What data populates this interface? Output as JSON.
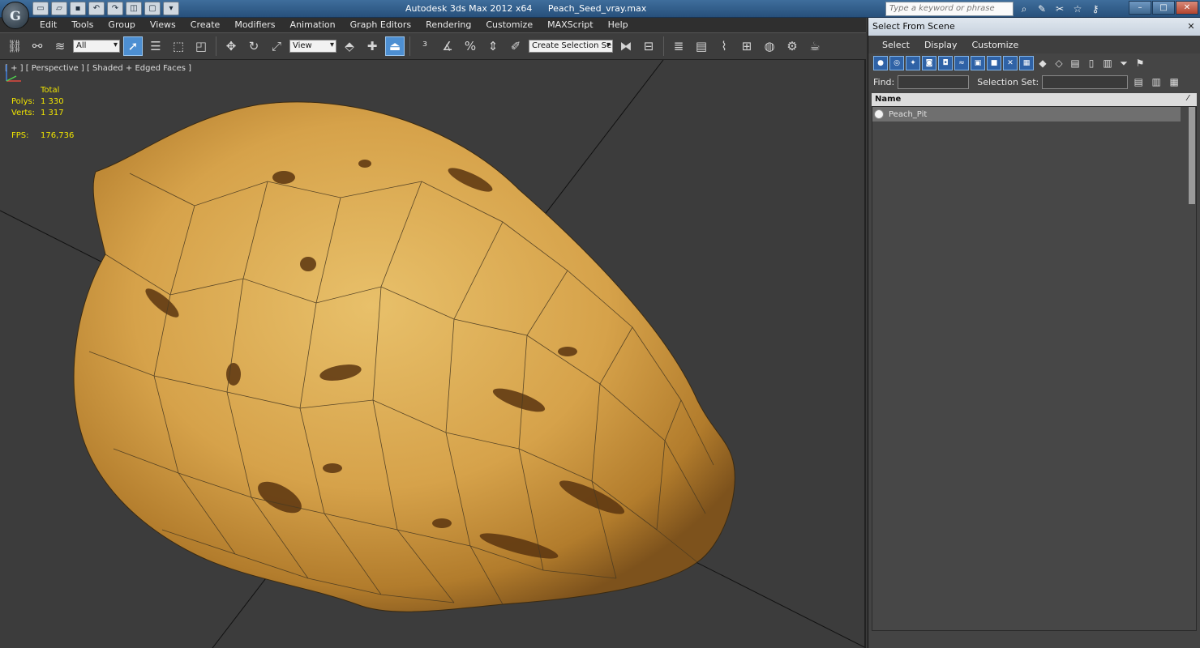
{
  "app": {
    "logo_letter": "G",
    "title_app": "Autodesk 3ds Max  2012 x64",
    "title_file": "Peach_Seed_vray.max",
    "search_placeholder": "Type a keyword or phrase"
  },
  "menus": [
    "Edit",
    "Tools",
    "Group",
    "Views",
    "Create",
    "Modifiers",
    "Animation",
    "Graph Editors",
    "Rendering",
    "Customize",
    "MAXScript",
    "Help"
  ],
  "toolbar": {
    "selection_filter": "All",
    "reference_coord": "View",
    "named_selection": "Create Selection Se"
  },
  "viewport": {
    "label": "[ + ] [ Perspective ] [ Shaded + Edged Faces ]",
    "stats_header": "Total",
    "polys_label": "Polys:",
    "polys_value": "1 330",
    "verts_label": "Verts:",
    "verts_value": "1 317",
    "fps_label": "FPS:",
    "fps_value": "176,736"
  },
  "panel": {
    "title": "Select From Scene",
    "menu": [
      "Select",
      "Display",
      "Customize"
    ],
    "find_label": "Find:",
    "selection_set_label": "Selection Set:",
    "column_name": "Name",
    "items": [
      {
        "name": "Peach_Pit"
      }
    ]
  },
  "colors": {
    "accent": "#4d8fd2",
    "stats_text": "#f0e400",
    "model_base": "#d9a84a"
  }
}
